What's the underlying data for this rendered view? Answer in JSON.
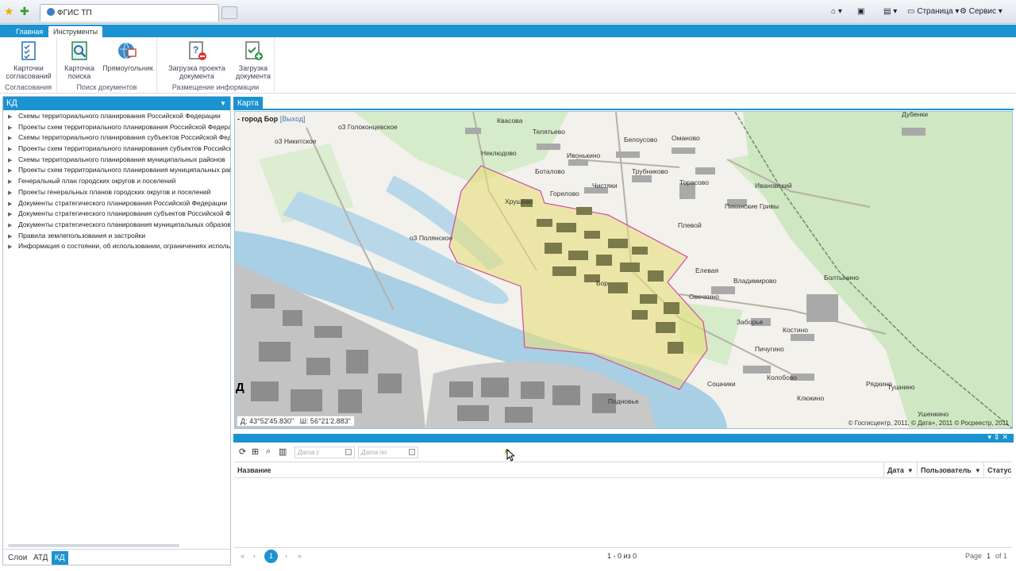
{
  "browser": {
    "tab_title": "ФГИС ТП",
    "buttons": [
      "Страница",
      "Сервис"
    ]
  },
  "ribbon": {
    "tabs": [
      "Главная",
      "Инструменты"
    ],
    "groups": [
      {
        "label": "Согласования",
        "buttons": [
          {
            "label": "Карточки согласований",
            "icon": "checklist-icon"
          }
        ]
      },
      {
        "label": "Поиск документов",
        "buttons": [
          {
            "label": "Карточка поиска",
            "icon": "search-card-icon"
          },
          {
            "label": "Прямоугольник",
            "icon": "globe-select-icon"
          }
        ]
      },
      {
        "label": "Размещение информации",
        "buttons": [
          {
            "label": "Загрузка проекта документа",
            "icon": "upload-project-icon"
          },
          {
            "label": "Загрузка документа",
            "icon": "upload-document-icon"
          }
        ]
      }
    ]
  },
  "left_panel": {
    "header": "КД",
    "tree": [
      "Схемы территориального планирования Российской Федерации",
      "Проекты схем территориального планирования Российской Федера",
      "Схемы территориального планирования субъектов Российской Феде",
      "Проекты схем территориального планирования субъектов Российск",
      "Схемы территориального планирования муниципальных районов",
      "Проекты схем территориального планирования муниципальных рай",
      "Генеральный план городских округов и поселений",
      "Проекты генеральных планов городских округов и поселений",
      "Документы стратегического планирования Российской Федерации",
      "Документы стратегического планирования субъектов Российской Фе",
      "Документы стратегического планирования муниципальных образов",
      "Правила землепользования и застройки",
      "Информация о состоянии, об использовании, ограничениях исполь"
    ],
    "bottom_tabs": [
      "Слои",
      "АТД",
      "КД"
    ]
  },
  "map": {
    "tab_label": "Карта",
    "title": "- город Бор",
    "exit_label": "[Выход]",
    "coords_lon": "Д: 43°52'45.830\"",
    "coords_lat": "Ш: 56°21'2.883\"",
    "copyright": "© Госгисцентр, 2011, © Дата+, 2011 © Росреестр, 2011",
    "edge_label": "Д",
    "places": [
      "Квасова",
      "Телятьево",
      "Белоусово",
      "Оманово",
      "Дубенки",
      "Неклюдово",
      "Ивонькино",
      "Трубниково",
      "Боталово",
      "Горелово",
      "Чистяки",
      "Торасово",
      "Ивановский",
      "Пикинские Гривы",
      "Хрущёво",
      "Плевой",
      "Бор",
      "Елевая",
      "Владимирово",
      "Болтынино",
      "Овечкино",
      "Заборье",
      "Костино",
      "Пичугино",
      "Колобово",
      "Сошники",
      "Рядкино",
      "Тушнино",
      "Подновье",
      "Клюкино",
      "Ушенкино",
      "о3 Никитское",
      "о3 Полянское",
      "о3 Голоконцевское"
    ],
    "colors": {
      "water": "#a8cfe4",
      "land": "#f3f1ec",
      "forest": "#cde6c0",
      "city": "#c3c3c3",
      "area_fill": "#e6df7a",
      "area_border": "#d04ba0"
    }
  },
  "toolbar": {
    "date_from_placeholder": "Дата с",
    "date_to_placeholder": "Дата по",
    "icons": [
      "refresh-icon",
      "hierarchy-icon",
      "search-icon",
      "columns-icon"
    ]
  },
  "grid": {
    "columns": [
      "Название",
      "Дата",
      "Пользователь",
      "Статус"
    ]
  },
  "pager": {
    "current_page": "1",
    "count_text": "1 - 0 из 0",
    "page_label": "Page",
    "page_value": "1",
    "of_label": "of 1"
  }
}
